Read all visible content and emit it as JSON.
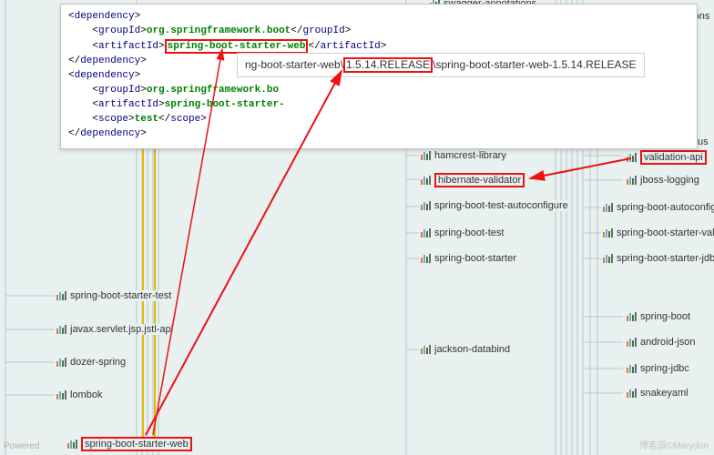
{
  "xml": {
    "dep_open": "<dependency>",
    "dep_close": "</dependency>",
    "gid_open": "<groupId>",
    "gid_close": "</groupId>",
    "aid_open": "<artifactId>",
    "aid_close": "</artifactId>",
    "scope_open": "<scope>",
    "scope_close": "</scope>",
    "gid_value": "org.springframework.boot",
    "gid_value_trunc": "org.springframework.bo",
    "aid_value1": "spring-boot-starter-web",
    "aid_value2_trunc": "spring-boot-starter-",
    "scope_value": "test"
  },
  "version_path": {
    "prefix": "ng-boot-starter-web\\",
    "highlight": "1.5.14.RELEASE",
    "suffix": "\\spring-boot-starter-web-1.5.14.RELEASE"
  },
  "nodes": {
    "swagger_annotations": "swagger-annotations",
    "ations_trunc": "ations",
    "hamcrest_library": "hamcrest-library",
    "hibernate_validator": "hibernate-validator",
    "validation_api": "validation-api",
    "us_trunc": "us",
    "jboss_logging": "jboss-logging",
    "sb_test_autoconfigure": "spring-boot-test-autoconfigure",
    "sb_autoconfigure": "spring-boot-autoconfigure",
    "sb_test": "spring-boot-test",
    "sb_starter_validatio": "spring-boot-starter-validatio",
    "sb_starter": "spring-boot-starter",
    "sb_starter_jdbc": "spring-boot-starter-jdbc -",
    "sb_starter_test": "spring-boot-starter-test",
    "jstl_api": "javax.servlet.jsp.jstl-api",
    "dozer_spring": "dozer-spring",
    "lombok": "lombok",
    "sb_starter_web": "spring-boot-starter-web",
    "jackson_databind": "jackson-databind",
    "spring_boot": "spring-boot",
    "android_json": "android-json",
    "spring_jdbc": "spring-jdbc",
    "snakeyaml": "snakeyaml"
  },
  "watermark_left": "Powered",
  "watermark_right": "博客园©Marydon"
}
